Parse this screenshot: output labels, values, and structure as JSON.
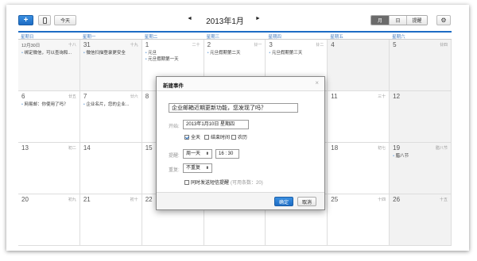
{
  "toolbar": {
    "add_label": "+",
    "mobile_icon": "mobile-phone-icon",
    "today_label": "今天",
    "prev_label": "◄",
    "next_label": "►",
    "month_title": "2013年1月",
    "views": [
      "月",
      "日",
      "提醒"
    ],
    "active_view": "月",
    "settings_icon": "gear-icon"
  },
  "weekdays": [
    "星期日",
    "星期一",
    "星期二",
    "星期三",
    "星期四",
    "星期五",
    "星期六"
  ],
  "weeks": [
    [
      {
        "day": "12月30日",
        "lunar": "十八",
        "events": [
          "绑定微信，可以查询和..."
        ]
      },
      {
        "day": "31",
        "lunar": "十九",
        "events": [
          "微信扫描登录更安全"
        ]
      },
      {
        "day": "1",
        "lunar": "二十",
        "events": [
          "元旦",
          "元旦假期第一天"
        ]
      },
      {
        "day": "2",
        "lunar": "廿一",
        "events": [
          "元旦假期第二天"
        ]
      },
      {
        "day": "3",
        "lunar": "廿二",
        "events": [
          "元旦假期第三天"
        ]
      },
      {
        "day": "4",
        "lunar": "",
        "events": []
      },
      {
        "day": "5",
        "lunar": "廿四",
        "events": []
      }
    ],
    [
      {
        "day": "6",
        "lunar": "廿五",
        "events": [
          "网易邮：你使用了吗？"
        ]
      },
      {
        "day": "7",
        "lunar": "廿六",
        "events": [
          "企业名片，您的企业..."
        ]
      },
      {
        "day": "8",
        "lunar": "",
        "events": []
      },
      {
        "day": "9",
        "lunar": "",
        "events": []
      },
      {
        "day": "10",
        "lunar": "",
        "events": []
      },
      {
        "day": "11",
        "lunar": "三十",
        "events": []
      },
      {
        "day": "12",
        "lunar": "",
        "events": []
      }
    ],
    [
      {
        "day": "13",
        "lunar": "初二",
        "events": []
      },
      {
        "day": "14",
        "lunar": "",
        "events": []
      },
      {
        "day": "15",
        "lunar": "",
        "events": []
      },
      {
        "day": "16",
        "lunar": "",
        "events": []
      },
      {
        "day": "17",
        "lunar": "",
        "events": []
      },
      {
        "day": "18",
        "lunar": "初七",
        "events": []
      },
      {
        "day": "19",
        "lunar": "腊八节",
        "events": [
          "腊八节"
        ]
      }
    ],
    [
      {
        "day": "20",
        "lunar": "初九",
        "events": []
      },
      {
        "day": "21",
        "lunar": "初十",
        "events": []
      },
      {
        "day": "22",
        "lunar": "",
        "events": []
      },
      {
        "day": "23",
        "lunar": "",
        "events": []
      },
      {
        "day": "24",
        "lunar": "",
        "events": []
      },
      {
        "day": "25",
        "lunar": "十四",
        "events": []
      },
      {
        "day": "26",
        "lunar": "十五",
        "events": []
      }
    ]
  ],
  "dialog": {
    "title": "新建事件",
    "close_label": "×",
    "event_title": "企业邮箱近期更新功能，您发现了吗？",
    "start_label": "开始:",
    "start_date": "2013年1月10日 星期四",
    "allday_label": "全天",
    "allday_checked": true,
    "end_time_label": "结束时间",
    "lunar_label": "农历",
    "reminder_label": "提醒:",
    "reminder_day": "周一天",
    "reminder_time": "16 : 30",
    "repeat_label": "重复:",
    "repeat_value": "不重复",
    "sms_label": "同时发送短信提醒",
    "sms_hint": "(可用条数：20)",
    "ok_label": "确定",
    "cancel_label": "取消"
  }
}
